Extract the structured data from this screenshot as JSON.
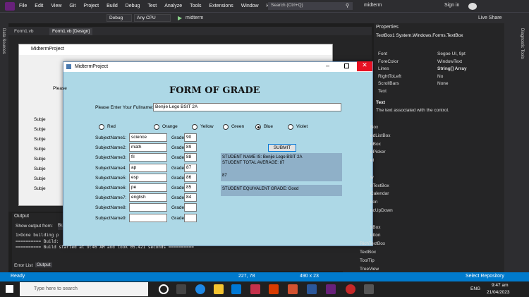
{
  "vs": {
    "menu": [
      "File",
      "Edit",
      "View",
      "Git",
      "Project",
      "Build",
      "Debug",
      "Test",
      "Analyze",
      "Tools",
      "Extensions",
      "Window",
      "Help"
    ],
    "search": "Search (Ctrl+Q)",
    "solution": "midterm",
    "signin": "Sign in",
    "liveshare": "Live Share",
    "config": "Debug",
    "platform": "Any CPU",
    "run": "midterm",
    "tabs": [
      "Form1.vb",
      "Form1.vb [Design]"
    ],
    "side_left": "Data Sources",
    "side_right": "Diagnostic Tools"
  },
  "bg_form": {
    "title": "MidtermProject",
    "labels": [
      "Please",
      "Subje",
      "Subje",
      "Subje",
      "Subje",
      "Subje",
      "Subje",
      "Subje",
      "Subje"
    ]
  },
  "app": {
    "title": "MidtermProject",
    "heading": "FORM OF GRADE",
    "name_label": "Please Enter Your Fullname:",
    "name_value": "Benjie Lego BSIT 2A",
    "colors": [
      "Red",
      "Orange",
      "Yellow",
      "Green",
      "Blue",
      "Violet"
    ],
    "selected_color": "Blue",
    "subjects": [
      {
        "label": "SubjectName1:",
        "value": "science",
        "grade_label": "Grade",
        "grade": "90"
      },
      {
        "label": "SubjectName2:",
        "value": "math",
        "grade_label": "Grade",
        "grade": "89"
      },
      {
        "label": "SubjectName3:",
        "value": "fil",
        "grade_label": "Grade",
        "grade": "88"
      },
      {
        "label": "SubjectName4:",
        "value": "ap",
        "grade_label": "Grade",
        "grade": "87"
      },
      {
        "label": "SubjectName5:",
        "value": "esp",
        "grade_label": "Grade",
        "grade": "86"
      },
      {
        "label": "SubjectName6:",
        "value": "pe",
        "grade_label": "Grade",
        "grade": "85"
      },
      {
        "label": "SubjectName7:",
        "value": "english",
        "grade_label": "Grade",
        "grade": "84"
      },
      {
        "label": "SubjectName8:",
        "value": "",
        "grade_label": "Grade",
        "grade": ""
      },
      {
        "label": "SubjectName9:",
        "value": "",
        "grade_label": "Grade",
        "grade": ""
      }
    ],
    "submit": "SUBMIT",
    "result1": "STUDENT NAME IS: Benjie Lego BSIT 2A",
    "result2": "STUDENT TOTAL AVERAGE: 87",
    "result3": "87",
    "result4": "STUDENT EQUIVALENT GRADE: Good"
  },
  "properties": {
    "title": "Properties",
    "object": "TextBox1  System.Windows.Forms.TextBox",
    "rows": [
      {
        "name": "Font",
        "value": "Segoe UI, 9pt"
      },
      {
        "name": "ForeColor",
        "value": "WindowText"
      },
      {
        "name": "Lines",
        "value": "String[] Array"
      },
      {
        "name": "RightToLeft",
        "value": "No"
      },
      {
        "name": "ScrollBars",
        "value": "None"
      },
      {
        "name": "Text",
        "value": ""
      }
    ],
    "desc_title": "Text",
    "desc": "The text associated with the control."
  },
  "toolbox": [
    "Box",
    "edListBox",
    "oBox",
    "ePicker",
    "el",
    "",
    "w",
    "dTextBox",
    "Calendar",
    "con",
    "ncUpDown",
    "",
    "sBox",
    "utton",
    "RichTextBox",
    "TextBox",
    "ToolTip",
    "TreeView"
  ],
  "output": {
    "title": "Output",
    "show_from": "Show output from:",
    "show_value": "Bu",
    "lines": [
      "1>Done building p",
      "========== Build:",
      "========== Build started at 9:46 AM and took 05.421 seconds =========="
    ],
    "tabs": [
      "Error List",
      "Output"
    ]
  },
  "status": {
    "ready": "Ready",
    "pos": "227, 78",
    "size": "490 x 23",
    "select_repo": "Select Repository"
  },
  "taskbar": {
    "search": "Type here to search",
    "time": "9:47 am",
    "date": "21/04/2023",
    "lang": "ENG"
  }
}
